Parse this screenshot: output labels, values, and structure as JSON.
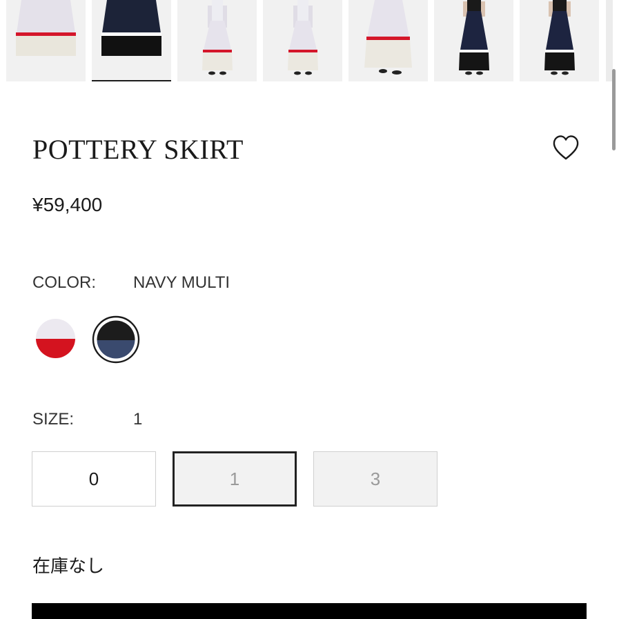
{
  "gallery": {
    "thumbnails": [
      {
        "name": "white-red-skirt-closeup",
        "top": "#e4e1ea",
        "stripe": "#d4162a",
        "bottom": "#e9e6dc",
        "kind": "closeup"
      },
      {
        "name": "navy-multi-skirt-closeup",
        "top": "#1c2338",
        "stripe": "#ffffff",
        "bottom": "#111111",
        "kind": "closeup"
      },
      {
        "name": "white-red-model-front",
        "top": "#e6e3ec",
        "stripe": "#d4162a",
        "bottom": "#ebe8e0",
        "kind": "model"
      },
      {
        "name": "white-red-model-side",
        "top": "#e6e3ec",
        "stripe": "#d4162a",
        "bottom": "#ebe8e0",
        "kind": "model"
      },
      {
        "name": "white-red-model-detail",
        "top": "#e6e3ec",
        "stripe": "#d4162a",
        "bottom": "#ebe8e0",
        "kind": "wide"
      },
      {
        "name": "navy-multi-model-front",
        "top": "#1d2440",
        "stripe": "#ffffff",
        "bottom": "#151515",
        "kind": "model-dark"
      },
      {
        "name": "navy-multi-model-side",
        "top": "#1d2440",
        "stripe": "#ffffff",
        "bottom": "#151515",
        "kind": "model-dark"
      }
    ],
    "selected_index": 1
  },
  "product": {
    "title": "POTTERY SKIRT",
    "price": "¥59,400",
    "wishlist_icon": "heart-outline-icon"
  },
  "color": {
    "label": "COLOR:",
    "selected_value": "NAVY MULTI",
    "options": [
      {
        "name": "white-red",
        "top": "#ece9f0",
        "bottom": "#d4131f",
        "selected": false
      },
      {
        "name": "navy-multi",
        "top": "#1c1c1c",
        "bottom": "#3a4a6e",
        "selected": true
      }
    ]
  },
  "size": {
    "label": "SIZE:",
    "selected_value": "1",
    "options": [
      {
        "label": "0",
        "available": true,
        "selected": false
      },
      {
        "label": "1",
        "available": false,
        "selected": true
      },
      {
        "label": "3",
        "available": false,
        "selected": false
      }
    ]
  },
  "stock_status": "在庫なし",
  "colors": {
    "text": "#1a1a1a",
    "border": "#cfcfcf",
    "disabled_text": "#9a9a9a",
    "button_dark": "#000000"
  }
}
